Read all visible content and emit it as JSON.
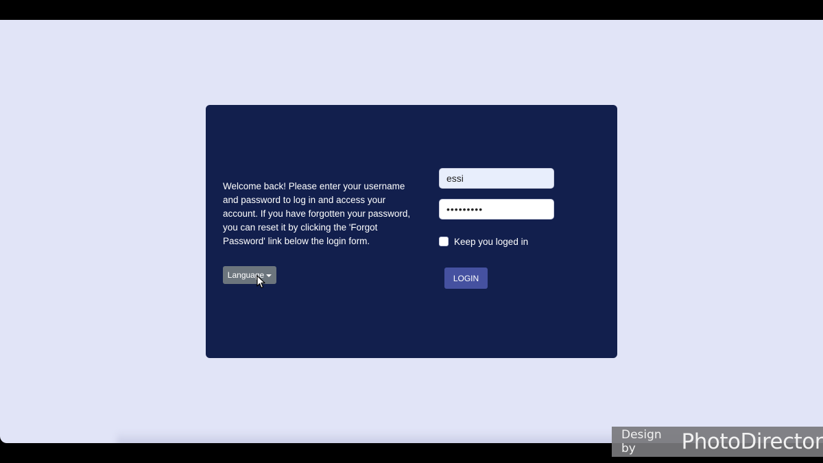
{
  "login_card": {
    "welcome_text": "Welcome back! Please enter your username and password to log in and access your account. If you have forgotten your password, you can reset it by clicking the 'Forgot Password' link below the login form.",
    "language_button_label": "Language",
    "username_value": "essi",
    "password_value": "•••••••••",
    "keep_logged_in_label": "Keep you loged in",
    "keep_logged_in_checked": false,
    "login_button_label": "LOGIN"
  },
  "watermark": {
    "prefix": "Design by",
    "brand": "PhotoDirector"
  },
  "colors": {
    "page_background": "#e1e4f7",
    "card_background": "#121f4d",
    "language_button": "#6c757d",
    "login_button": "#4551a0"
  },
  "icons": {
    "language_caret": "chevron-down-icon",
    "mouse_pointer": "cursor-icon"
  }
}
